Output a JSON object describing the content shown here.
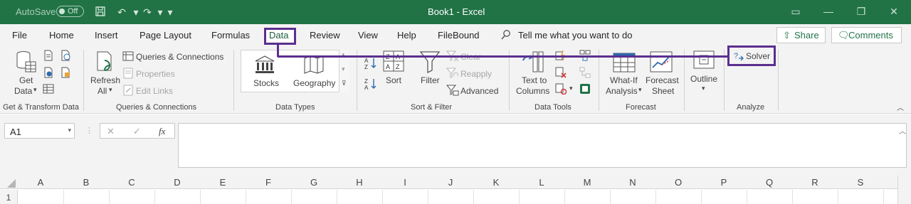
{
  "titlebar": {
    "autosave_label": "AutoSave",
    "autosave_state": "Off",
    "title": "Book1  -  Excel"
  },
  "menu": {
    "items": [
      "File",
      "Home",
      "Insert",
      "Page Layout",
      "Formulas",
      "Data",
      "Review",
      "View",
      "Help",
      "FileBound"
    ],
    "active": "Data",
    "tell_me": "Tell me what you want to do",
    "share": "Share",
    "comments": "Comments"
  },
  "ribbon": {
    "get_transform": {
      "get_data": "Get",
      "get_data2": "Data",
      "label": "Get & Transform Data"
    },
    "queries": {
      "refresh": "Refresh",
      "refresh2": "All",
      "qc": "Queries & Connections",
      "properties": "Properties",
      "edit_links": "Edit Links",
      "label": "Queries & Connections"
    },
    "data_types": {
      "stocks": "Stocks",
      "geography": "Geography",
      "label": "Data Types"
    },
    "sort_filter": {
      "sort": "Sort",
      "filter": "Filter",
      "clear": "Clear",
      "reapply": "Reapply",
      "advanced": "Advanced",
      "label": "Sort & Filter"
    },
    "data_tools": {
      "text_to_columns": "Text to",
      "text_to_columns2": "Columns",
      "label": "Data Tools"
    },
    "forecast": {
      "whatif": "What-If",
      "whatif2": "Analysis",
      "forecast_sheet": "Forecast",
      "forecast_sheet2": "Sheet",
      "label": "Forecast"
    },
    "outline": {
      "outline": "Outline",
      "label": ""
    },
    "analyze": {
      "solver": "Solver",
      "label": "Analyze"
    }
  },
  "formula_bar": {
    "name_box": "A1",
    "cancel_symbol": "✕",
    "enter_symbol": "✓",
    "fx_symbol": "fx",
    "value": ""
  },
  "grid": {
    "columns": [
      "A",
      "B",
      "C",
      "D",
      "E",
      "F",
      "G",
      "H",
      "I",
      "J",
      "K",
      "L",
      "M",
      "N",
      "O",
      "P",
      "Q",
      "R",
      "S"
    ],
    "first_row": "1"
  },
  "colors": {
    "brand_green": "#217346",
    "highlight_purple": "#5b2f8f"
  }
}
